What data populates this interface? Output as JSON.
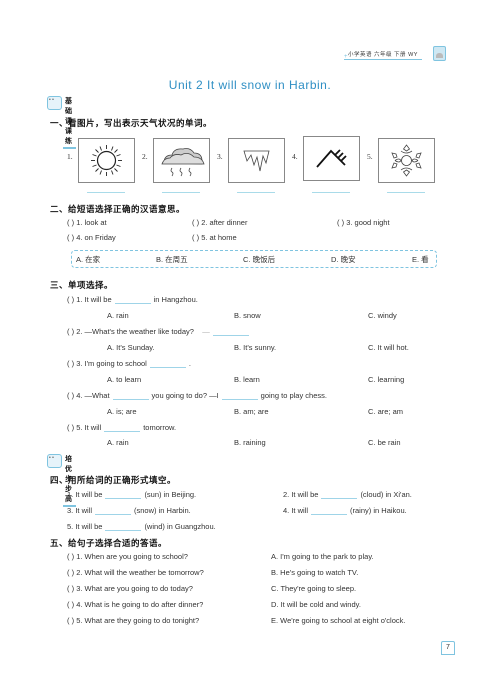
{
  "header": {
    "book_tag": "小学英语 六年级 下册 WY",
    "unit_title": "Unit 2    It will snow in Harbin."
  },
  "badges": {
    "basic": "基础课课练",
    "advanced": "培优步步高"
  },
  "section1": {
    "title": "一、看图片，写出表示天气状况的单词。",
    "pictures": [
      {
        "num": "1.",
        "icon": "sun-icon"
      },
      {
        "num": "2.",
        "icon": "rain-cloud-icon"
      },
      {
        "num": "3.",
        "icon": "icicle-icon"
      },
      {
        "num": "4.",
        "icon": "wind-icon"
      },
      {
        "num": "5.",
        "icon": "snowflake-icon"
      }
    ]
  },
  "section2": {
    "title": "二、给短语选择正确的汉语意思。",
    "items": [
      {
        "paren": "(      )",
        "text": "1. look at"
      },
      {
        "paren": "(      )",
        "text": "2. after dinner"
      },
      {
        "paren": "(      )",
        "text": "3. good night"
      },
      {
        "paren": "(      )",
        "text": "4. on Friday"
      },
      {
        "paren": "(      )",
        "text": "5. at home"
      }
    ],
    "options": [
      "A. 在家",
      "B. 在周五",
      "C. 晚饭后",
      "D. 晚安",
      "E. 看"
    ]
  },
  "section3": {
    "title": "三、单项选择。",
    "questions": [
      {
        "paren": "(      )",
        "pre": "1. It will be",
        "post": "in Hangzhou.",
        "choices": [
          "A. rain",
          "B. snow",
          "C. windy"
        ]
      },
      {
        "paren": "(      )",
        "pre": "2. —What's the weather like today?",
        "mid": "—",
        "post": "",
        "choices": [
          "A. It's Sunday.",
          "B. It's sunny.",
          "C. It will hot."
        ]
      },
      {
        "paren": "(      )",
        "pre": "3. I'm going to school",
        "post": ".",
        "choices": [
          "A. to learn",
          "B. learn",
          "C. learning"
        ]
      },
      {
        "paren": "(      )",
        "pre": "4. —What",
        "mid": "you going to do?    —I",
        "post": "going to play chess.",
        "choices": [
          "A. is; are",
          "B. am; are",
          "C. are; am"
        ]
      },
      {
        "paren": "(      )",
        "pre": "5. It will",
        "post": "tomorrow.",
        "choices": [
          "A. rain",
          "B. raining",
          "C. be rain"
        ]
      }
    ]
  },
  "section4": {
    "title": "四、用所给词的正确形式填空。",
    "items": [
      {
        "pre": "1. It will be",
        "post": "(sun) in Beijing."
      },
      {
        "pre": "2. It will be",
        "post": "(cloud) in Xi'an."
      },
      {
        "pre": "3. It will",
        "post": "(snow) in Harbin."
      },
      {
        "pre": "4. It will",
        "post": "(rainy) in Haikou."
      },
      {
        "pre": "5. It will be",
        "post": "(wind) in Guangzhou."
      }
    ]
  },
  "section5": {
    "title": "五、给句子选择合适的答语。",
    "questions": [
      {
        "paren": "(      )",
        "text": "1. When are you going to school?"
      },
      {
        "paren": "(      )",
        "text": "2. What will the weather be tomorrow?"
      },
      {
        "paren": "(      )",
        "text": "3. What are you going to do today?"
      },
      {
        "paren": "(      )",
        "text": "4. What is he going to do after dinner?"
      },
      {
        "paren": "(      )",
        "text": "5. What are they going to do tonight?"
      }
    ],
    "answers": [
      "A. I'm going to the park to play.",
      "B. He's going to watch TV.",
      "C. They're going to sleep.",
      "D. It will be cold and windy.",
      "E. We're going to school at eight o'clock."
    ]
  },
  "page_number": "7"
}
